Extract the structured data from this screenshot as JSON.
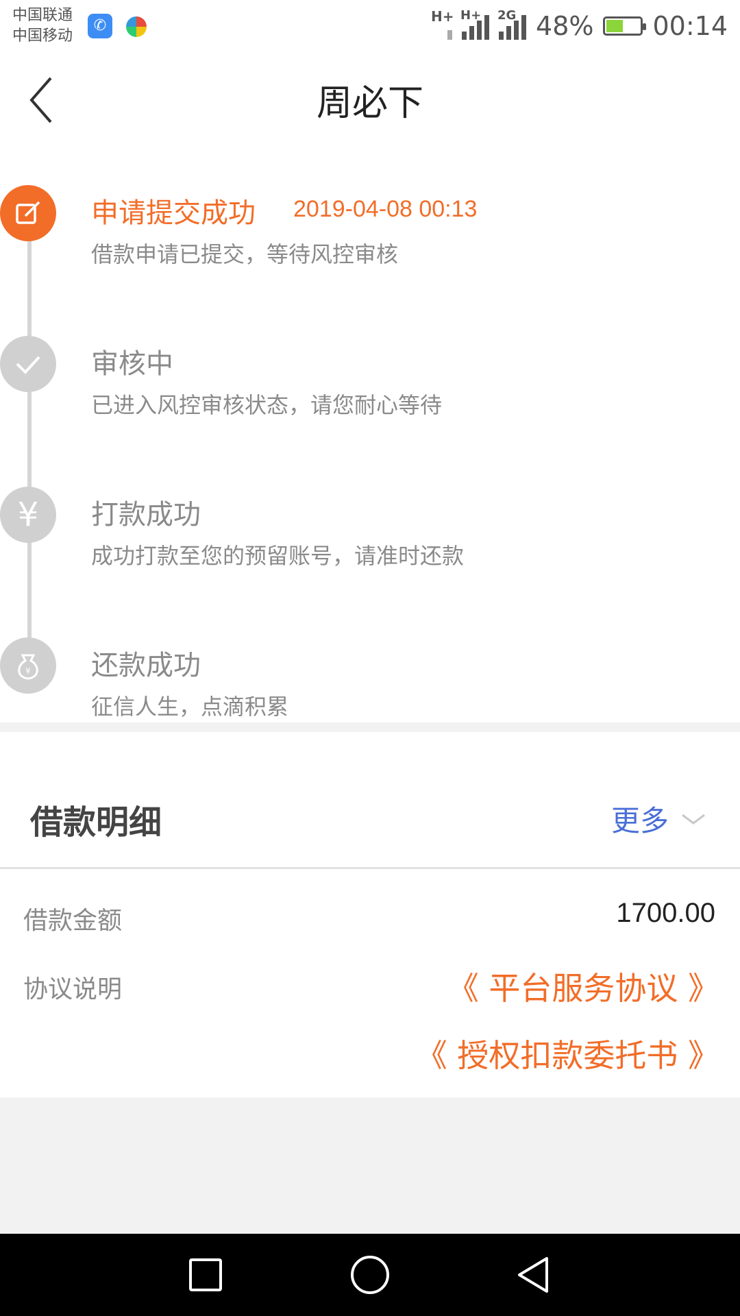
{
  "status_bar": {
    "carrier_1": "中国联通",
    "carrier_2": "中国移动",
    "net_1": "H+",
    "net_2": "H+",
    "net_3": "2G",
    "battery_pct": "48%",
    "battery_level": 0.48,
    "time": "00:14"
  },
  "header": {
    "title": "周必下"
  },
  "timeline": {
    "steps": [
      {
        "title": "申请提交成功",
        "time": "2019-04-08 00:13",
        "desc": "借款申请已提交，等待风控审核",
        "icon": "edit-icon",
        "active": true
      },
      {
        "title": "审核中",
        "desc": "已进入风控审核状态，请您耐心等待",
        "icon": "check-icon",
        "active": false
      },
      {
        "title": "打款成功",
        "desc": "成功打款至您的预留账号，请准时还款",
        "icon": "yen-icon",
        "active": false
      },
      {
        "title": "还款成功",
        "desc": "征信人生，点滴积累",
        "icon": "money-bag-icon",
        "active": false
      }
    ]
  },
  "details": {
    "title": "借款明细",
    "more_label": "更多",
    "amount_label": "借款金额",
    "amount_value": "1700.00",
    "agreement_label": "协议说明",
    "link_1": "《 平台服务协议 》",
    "link_2": "《 授权扣款委托书 》"
  },
  "colors": {
    "accent": "#f26d28",
    "link_blue": "#4a6fd6",
    "inactive": "#d0d0d0"
  }
}
